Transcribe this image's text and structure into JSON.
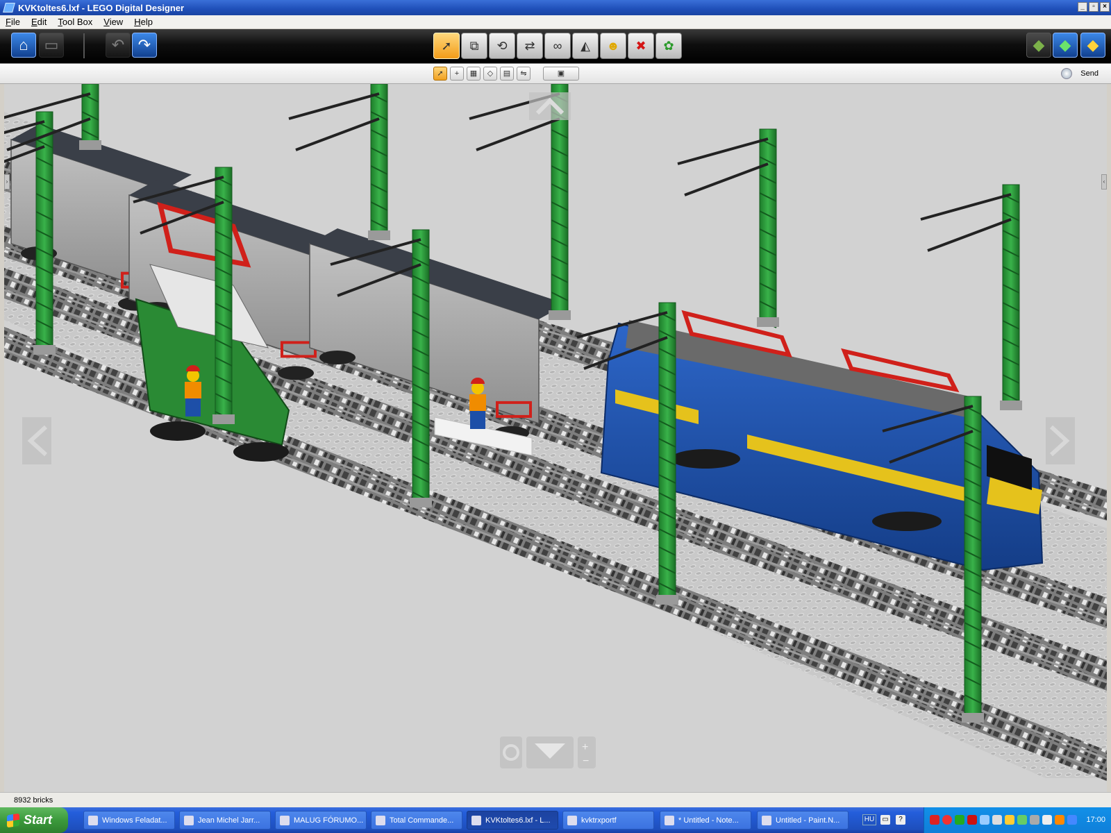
{
  "window": {
    "title": "KVKtoltes6.lxf - LEGO Digital Designer"
  },
  "menu": [
    "File",
    "Edit",
    "Tool Box",
    "View",
    "Help"
  ],
  "toolbar": {
    "left": [
      {
        "name": "home-button",
        "icon": "home-icon",
        "glyph": "⌂",
        "enabled": true
      },
      {
        "name": "save-button",
        "icon": "save-icon",
        "glyph": "▭",
        "enabled": false
      },
      {
        "name": "undo-button",
        "icon": "undo-icon",
        "glyph": "↶",
        "enabled": false
      },
      {
        "name": "redo-button",
        "icon": "redo-icon",
        "glyph": "↷",
        "enabled": true
      }
    ],
    "tools": [
      {
        "name": "select-tool",
        "icon": "cursor-icon",
        "glyph": "➚",
        "active": true
      },
      {
        "name": "clone-tool",
        "icon": "clone-icon",
        "glyph": "⧉",
        "active": false
      },
      {
        "name": "hinge-tool",
        "icon": "hinge-icon",
        "glyph": "⟲",
        "active": false
      },
      {
        "name": "hinge-align-tool",
        "icon": "hinge-align-icon",
        "glyph": "⇄",
        "active": false
      },
      {
        "name": "flex-tool",
        "icon": "flex-icon",
        "glyph": "∞",
        "active": false
      },
      {
        "name": "paint-tool",
        "icon": "paint-bucket-icon",
        "glyph": "◭",
        "active": false
      },
      {
        "name": "hide-tool",
        "icon": "minifig-head-icon",
        "glyph": "☻",
        "active": false
      },
      {
        "name": "delete-tool",
        "icon": "delete-x-icon",
        "glyph": "✖",
        "active": false
      },
      {
        "name": "decorate-tool",
        "icon": "decorate-icon",
        "glyph": "✿",
        "active": false
      }
    ],
    "right": [
      {
        "name": "build-mode-button",
        "icon": "build-mode-icon"
      },
      {
        "name": "view-mode-button",
        "icon": "view-mode-icon"
      },
      {
        "name": "building-guide-button",
        "icon": "building-guide-icon"
      }
    ]
  },
  "subtoolbar": {
    "modes": [
      {
        "name": "single-select",
        "glyph": "➚",
        "active": true
      },
      {
        "name": "connected-select",
        "glyph": "+",
        "active": false
      },
      {
        "name": "same-color-select",
        "glyph": "▦",
        "active": false
      },
      {
        "name": "same-shape-select",
        "glyph": "◇",
        "active": false
      },
      {
        "name": "same-type-select",
        "glyph": "▤",
        "active": false
      },
      {
        "name": "invert-select",
        "glyph": "⇋",
        "active": false
      }
    ],
    "send_label": "Send"
  },
  "status": {
    "brick_count": "8932 bricks"
  },
  "scene": {
    "colors": {
      "background": "#d2d2d2",
      "baseplate": "#c8c8c8",
      "track": "#6a6a6a",
      "sleeper": "#3a3a3a",
      "pole": "#2f9b3c",
      "loco_body": "#1d4fa8",
      "loco_stripe": "#e5c21c",
      "wagon": "#a9a9a9",
      "red": "#d0201a",
      "green_loco": "#2a8a34"
    }
  },
  "taskbar": {
    "start_label": "Start",
    "tasks": [
      {
        "label": "Windows Feladat...",
        "icon": "task-manager-icon",
        "active": false
      },
      {
        "label": "Jean Michel Jarr...",
        "icon": "media-player-icon",
        "active": false
      },
      {
        "label": "MALUG FÓRUMO...",
        "icon": "firefox-icon",
        "active": false
      },
      {
        "label": "Total Commande...",
        "icon": "floppy-icon",
        "active": false
      },
      {
        "label": "KVKtoltes6.lxf - L...",
        "icon": "lego-designer-icon",
        "active": true
      },
      {
        "label": "kvktrxportf",
        "icon": "folder-icon",
        "active": false
      },
      {
        "label": "* Untitled - Note...",
        "icon": "notepad-icon",
        "active": false
      },
      {
        "label": "Untitled - Paint.N...",
        "icon": "paint-icon",
        "active": false
      }
    ],
    "language": "HU",
    "clock": "17:00"
  }
}
